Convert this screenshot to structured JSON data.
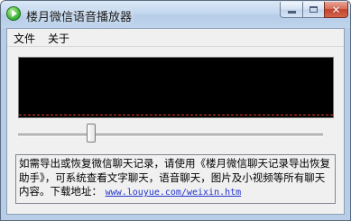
{
  "window": {
    "title": "楼月微信语音播放器",
    "app_icon": "play-circle-icon",
    "controls": {
      "minimize_icon": "minimize-icon",
      "maximize_icon": "maximize-icon",
      "close_icon": "close-icon"
    }
  },
  "menu": {
    "items": [
      "文件",
      "关于"
    ]
  },
  "player": {
    "background_color": "#000000",
    "progress_line_color": "#e23a2a"
  },
  "seek": {
    "position_fraction": 0.24
  },
  "info": {
    "text": "如需导出或恢复微信聊天记录，请使用《楼月微信聊天记录导出恢复助手》，可系统查看文字聊天，语音聊天，图片及小视频等所有聊天内容。下载地址：",
    "link": "www.louyue.com/weixin.htm",
    "link_color": "#2233cc"
  }
}
